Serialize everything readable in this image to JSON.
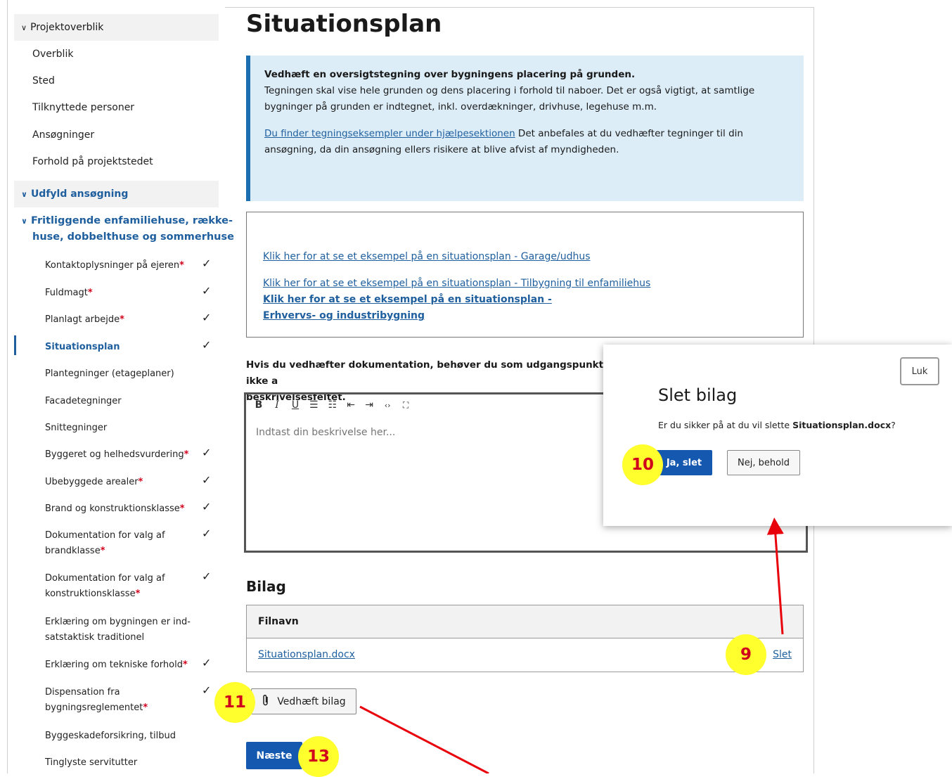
{
  "sidebar": {
    "overview_heading": "Projektoverblik",
    "overview_items": [
      "Overblik",
      "Sted",
      "Tilknyttede personer",
      "Ansøgninger",
      "Forhold på projektstedet"
    ],
    "fill_heading": "Udfyld ansøgning",
    "category_line1": "Fritliggende enfamiliehuse, række-",
    "category_line2": "huse, dobbelthuse og sommerhuse",
    "steps": [
      {
        "line1": "Kontaktoplysninger på ejeren",
        "line2": "",
        "required": "*",
        "check": "✓"
      },
      {
        "line1": "Fuldmagt",
        "line2": "",
        "required": "*",
        "check": "✓"
      },
      {
        "line1": "Planlagt arbejde",
        "line2": "",
        "required": "*",
        "check": "✓"
      },
      {
        "line1": "Situationsplan",
        "line2": "",
        "required": "",
        "check": "✓"
      },
      {
        "line1": "Plantegninger (etageplaner)",
        "line2": "",
        "required": "",
        "check": ""
      },
      {
        "line1": "Facadetegninger",
        "line2": "",
        "required": "",
        "check": ""
      },
      {
        "line1": "Snittegninger",
        "line2": "",
        "required": "",
        "check": ""
      },
      {
        "line1": "Byggeret og helhedsvurdering",
        "line2": "",
        "required": "*",
        "check": "✓"
      },
      {
        "line1": "Ubebyggede arealer",
        "line2": "",
        "required": "*",
        "check": "✓"
      },
      {
        "line1": "Brand og konstruktionsklasse",
        "line2": "",
        "required": "*",
        "check": "✓"
      },
      {
        "line1": "Dokumentation for valg af",
        "line2": "brandklasse",
        "required": "*",
        "check": "✓"
      },
      {
        "line1": "Dokumentation for valg af",
        "line2": "konstruktionsklasse",
        "required": "*",
        "check": "✓"
      },
      {
        "line1": "Erklæring om bygningen er ind-",
        "line2": "satstaktisk traditionel",
        "required": "",
        "check": ""
      },
      {
        "line1": "Erklæring om tekniske forhold",
        "line2": "",
        "required": "*",
        "check": "✓"
      },
      {
        "line1": "Dispensation fra",
        "line2": "bygningsreglementet",
        "required": "*",
        "check": "✓"
      },
      {
        "line1": "Byggeskadeforsikring, tilbud",
        "line2": "",
        "required": "",
        "check": ""
      },
      {
        "line1": "Tinglyste servitutter",
        "line2": "",
        "required": "",
        "check": ""
      }
    ]
  },
  "main": {
    "title": "Situationsplan",
    "info": {
      "bold": "Vedhæft en oversigtstegning over bygningens placering på grunden.",
      "text": "Tegningen skal vise hele grunden og dens placering i forhold til naboer. Det er også vigtigt, at samtlige bygninger på grunden er indtegnet, inkl. overdækninger, drivhuse, legehuse m.m.",
      "link": "Du finder tegningseksempler under hjælpesektionen",
      "after_link": " Det anbefales at du vedhæfter tegninger til din ansøgning, da din ansøgning ellers risikere at blive afvist af myndigheden."
    },
    "examples": [
      "Klik her for at se et eksempel på en situationsplan - Garage/udhus",
      "Klik her for at se et eksempel på en situationsplan - Tilbygning til enfamiliehus",
      "Klik her for at se et eksempel på en situationsplan - Erhvervs- og industribygning"
    ],
    "hint_line1": "Hvis du vedhæfter dokumentation, behøver du som udgangspunkt ikke a",
    "hint_line2": "beskrivelsesfeltet.",
    "editor": {
      "toolbar": [
        "B",
        "I",
        "U",
        "☰",
        "☷",
        "⇤",
        "⇥",
        "‹›",
        "⛶"
      ],
      "placeholder": "Indtast din beskrivelse her..."
    },
    "attachments_heading": "Bilag",
    "table": {
      "header": "Filnavn",
      "rows": [
        {
          "filename": "Situationsplan.docx",
          "action": "Slet"
        }
      ]
    },
    "attach_button": "Vedhæft bilag",
    "next_button": "Næste"
  },
  "modal": {
    "close_label": "Luk",
    "title": "Slet bilag",
    "question_prefix": "Er du sikker på at du vil slette ",
    "question_file": "Situationsplan.docx",
    "question_suffix": "?",
    "confirm": "Ja, slet",
    "cancel": "Nej, behold"
  },
  "markers": {
    "m9": "9",
    "m10": "10",
    "m11": "11",
    "m13": "13"
  },
  "colors": {
    "accent": "#1558b0",
    "link": "#1f5f9e",
    "marker_fill": "#ffff2e",
    "marker_text": "#d0021b",
    "info_bg": "#dcedf8",
    "arrow": "#e8000b"
  }
}
